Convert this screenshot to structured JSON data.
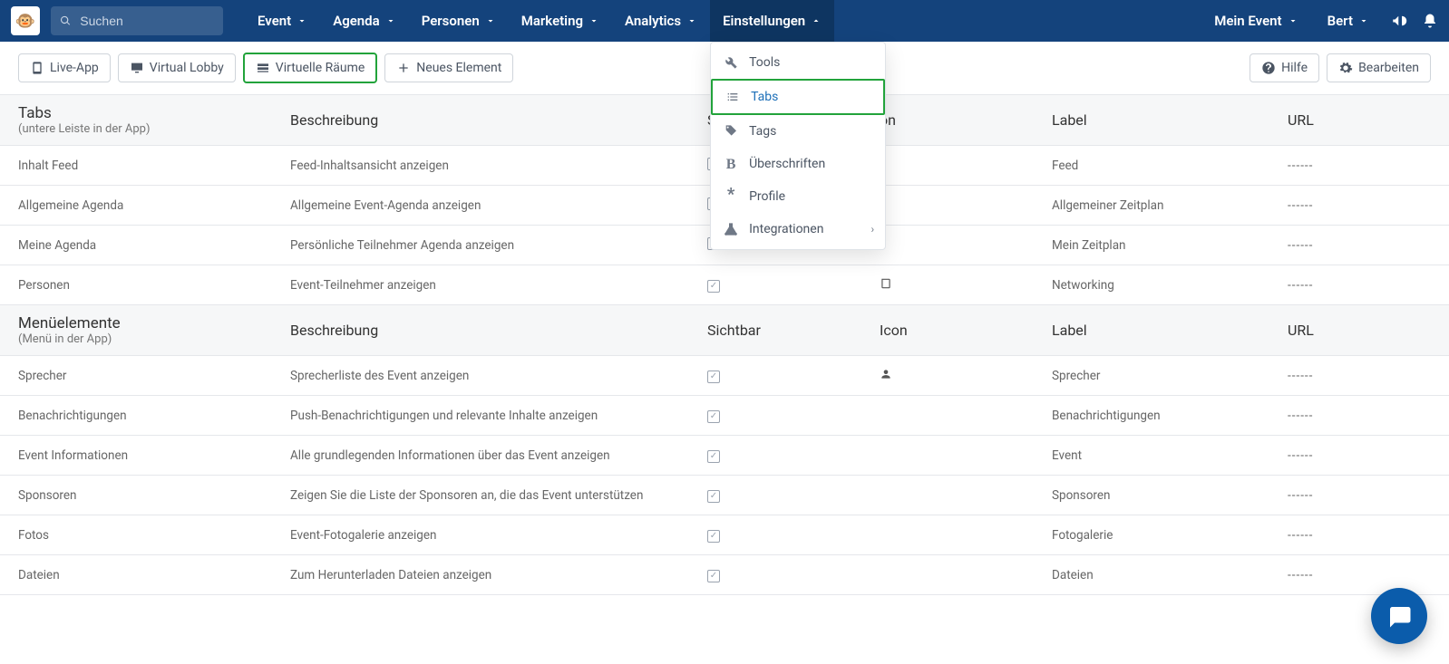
{
  "search": {
    "placeholder": "Suchen"
  },
  "nav": {
    "items": [
      "Event",
      "Agenda",
      "Personen",
      "Marketing",
      "Analytics",
      "Einstellungen"
    ],
    "active_index": 5,
    "right": {
      "event": "Mein Event",
      "user": "Bert"
    }
  },
  "dropdown": {
    "items": [
      {
        "label": "Tools",
        "icon": "wrench"
      },
      {
        "label": "Tabs",
        "icon": "list",
        "selected": true
      },
      {
        "label": "Tags",
        "icon": "tag"
      },
      {
        "label": "Überschriften",
        "icon": "bold"
      },
      {
        "label": "Profile",
        "icon": "asterisk"
      },
      {
        "label": "Integrationen",
        "icon": "flask",
        "submenu": true
      }
    ]
  },
  "toolbar": {
    "live_app": "Live-App",
    "virtual_lobby": "Virtual Lobby",
    "virtual_rooms": "Virtuelle Räume",
    "new_element": "Neues Element",
    "help": "Hilfe",
    "edit": "Bearbeiten"
  },
  "sections": [
    {
      "title": "Tabs",
      "subtitle": "(untere Leiste in der App)",
      "columns": {
        "desc": "Beschreibung",
        "visible": "S",
        "icon": "on",
        "label": "Label",
        "url": "URL"
      },
      "rows": [
        {
          "name": "Inhalt Feed",
          "desc": "Feed-Inhaltsansicht anzeigen",
          "visible": false,
          "icon": "",
          "label": "Feed",
          "url": "------"
        },
        {
          "name": "Allgemeine Agenda",
          "desc": "Allgemeine Event-Agenda anzeigen",
          "visible": false,
          "icon": "",
          "label": "Allgemeiner Zeitplan",
          "url": "------"
        },
        {
          "name": "Meine Agenda",
          "desc": "Persönliche Teilnehmer Agenda anzeigen",
          "visible": false,
          "icon": "",
          "label": "Mein Zeitplan",
          "url": "------"
        },
        {
          "name": "Personen",
          "desc": "Event-Teilnehmer anzeigen",
          "visible": true,
          "icon": "book",
          "label": "Networking",
          "url": "------"
        }
      ]
    },
    {
      "title": "Menüelemente",
      "subtitle": "(Menü in der App)",
      "columns": {
        "desc": "Beschreibung",
        "visible": "Sichtbar",
        "icon": "Icon",
        "label": "Label",
        "url": "URL"
      },
      "rows": [
        {
          "name": "Sprecher",
          "desc": "Sprecherliste des Event anzeigen",
          "visible": true,
          "icon": "person",
          "label": "Sprecher",
          "url": "------"
        },
        {
          "name": "Benachrichtigungen",
          "desc": "Push-Benachrichtigungen und relevante Inhalte anzeigen",
          "visible": true,
          "icon": "",
          "label": "Benachrichtigungen",
          "url": "------"
        },
        {
          "name": "Event Informationen",
          "desc": "Alle grundlegenden Informationen über das Event anzeigen",
          "visible": true,
          "icon": "",
          "label": "Event",
          "url": "------"
        },
        {
          "name": "Sponsoren",
          "desc": "Zeigen Sie die Liste der Sponsoren an, die das Event unterstützen",
          "visible": true,
          "icon": "",
          "label": "Sponsoren",
          "url": "------"
        },
        {
          "name": "Fotos",
          "desc": "Event-Fotogalerie anzeigen",
          "visible": true,
          "icon": "",
          "label": "Fotogalerie",
          "url": "------"
        },
        {
          "name": "Dateien",
          "desc": "Zum Herunterladen Dateien anzeigen",
          "visible": true,
          "icon": "",
          "label": "Dateien",
          "url": "------"
        }
      ]
    }
  ]
}
